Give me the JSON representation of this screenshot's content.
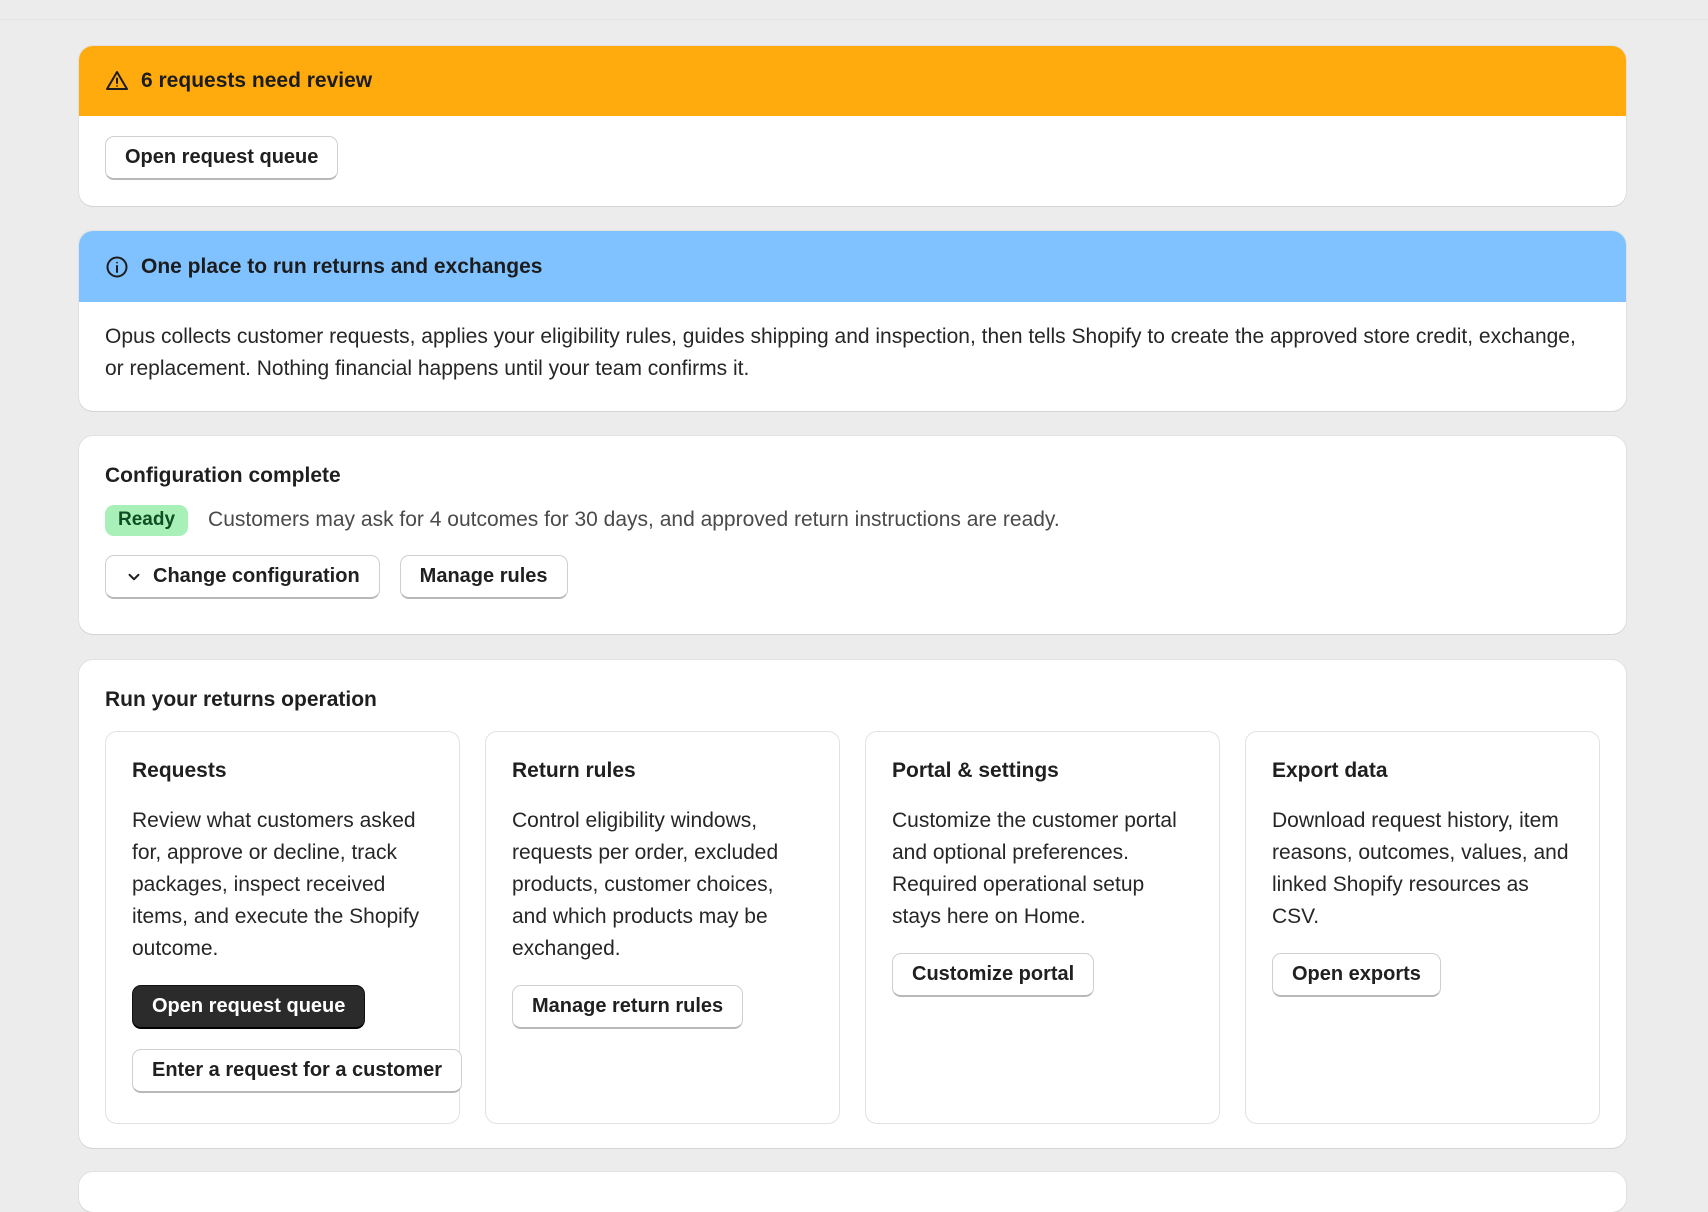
{
  "review_banner": {
    "title": "6 requests need review",
    "button": "Open request queue",
    "icon": "warning-triangle-icon",
    "color": "#ffab0d"
  },
  "info_banner": {
    "title": "One place to run returns and exchanges",
    "text": "Opus collects customer requests, applies your eligibility rules, guides shipping and inspection, then tells Shopify to create the approved store credit, exchange, or replacement. Nothing financial happens until your team confirms it.",
    "icon": "info-circle-icon",
    "color": "#80c2ff"
  },
  "configuration": {
    "title": "Configuration complete",
    "badge": "Ready",
    "badge_color": "#a8f0b8",
    "summary": "Customers may ask for 4 outcomes for 30 days, and approved return instructions are ready.",
    "change_button": "Change configuration",
    "rules_button": "Manage rules"
  },
  "operations": {
    "title": "Run your returns operation",
    "cards": [
      {
        "title": "Requests",
        "text": "Review what customers asked for, approve or decline, track packages, inspect received items, and execute the Shopify outcome.",
        "primary_button": "Open request queue",
        "secondary_button": "Enter a request for a customer"
      },
      {
        "title": "Return rules",
        "text": "Control eligibility windows, requests per order, excluded products, customer choices, and which products may be exchanged.",
        "button": "Manage return rules"
      },
      {
        "title": "Portal & settings",
        "text": "Customize the customer portal and optional preferences. Required operational setup stays here on Home.",
        "button": "Customize portal"
      },
      {
        "title": "Export data",
        "text": "Download request history, item reasons, outcomes, values, and linked Shopify resources as CSV.",
        "button": "Open exports"
      }
    ]
  }
}
